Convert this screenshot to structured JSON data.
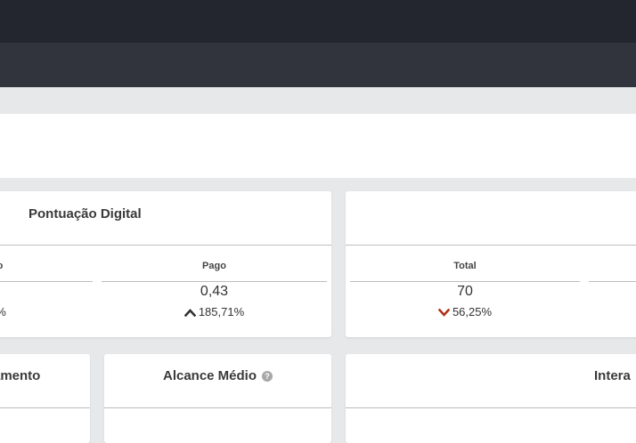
{
  "cards": {
    "pontuacao": {
      "title": "Pontuação Digital",
      "left_sub": {
        "label_fragment": "o",
        "change_fragment": "%"
      },
      "pago": {
        "label": "Pago",
        "value": "0,43",
        "change": "185,71%",
        "direction": "up"
      }
    },
    "total_card": {
      "total": {
        "label": "Total",
        "value": "70",
        "change": "56,25%",
        "direction": "down"
      }
    },
    "engajamento": {
      "title_fragment": "amento"
    },
    "alcance": {
      "title": "Alcance Médio",
      "help_icon": "?"
    },
    "interacoes": {
      "title_fragment": "Intera"
    }
  },
  "colors": {
    "up_arrow": "#333333",
    "down_arrow": "#b0321c"
  }
}
